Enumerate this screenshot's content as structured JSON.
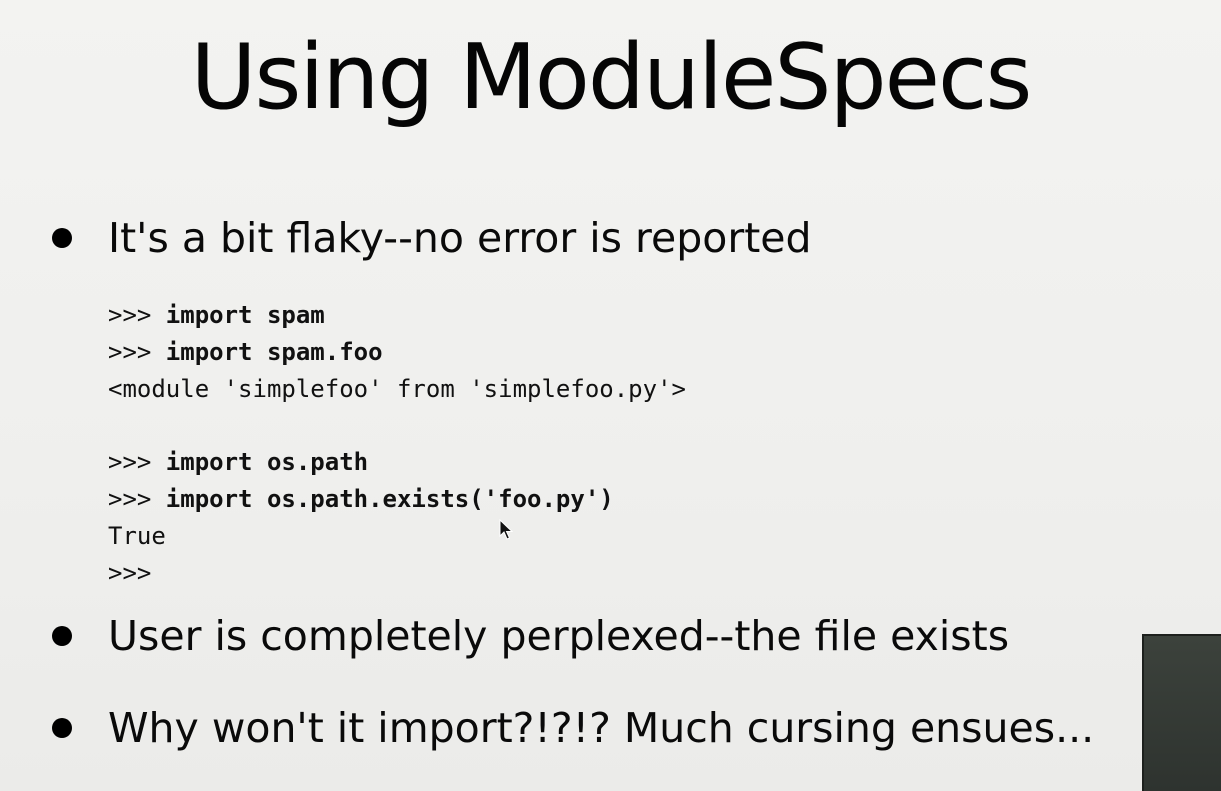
{
  "slide": {
    "title": "Using ModuleSpecs",
    "bullets": [
      "It's a bit flaky--no error is reported",
      "User is completely perplexed--the file exists",
      "Why won't it import?!?!?  Much cursing ensues..."
    ],
    "code": [
      {
        "prompt": ">>> ",
        "command": "import spam",
        "output": ""
      },
      {
        "prompt": ">>> ",
        "command": "import spam.foo",
        "output": ""
      },
      {
        "prompt": "",
        "command": "",
        "output": "<module 'simplefoo' from 'simplefoo.py'>"
      },
      {
        "prompt": "",
        "command": "",
        "output": ""
      },
      {
        "prompt": ">>> ",
        "command": "import os.path",
        "output": ""
      },
      {
        "prompt": ">>> ",
        "command": "import os.path.exists('foo.py')",
        "output": ""
      },
      {
        "prompt": "",
        "command": "",
        "output": "True"
      },
      {
        "prompt": ">>>",
        "command": "",
        "output": ""
      }
    ]
  },
  "icons": {
    "cursor": "mouse-pointer-icon"
  },
  "colors": {
    "background": "#f1f1ef",
    "text": "#000000",
    "overlay": "#343a35"
  }
}
